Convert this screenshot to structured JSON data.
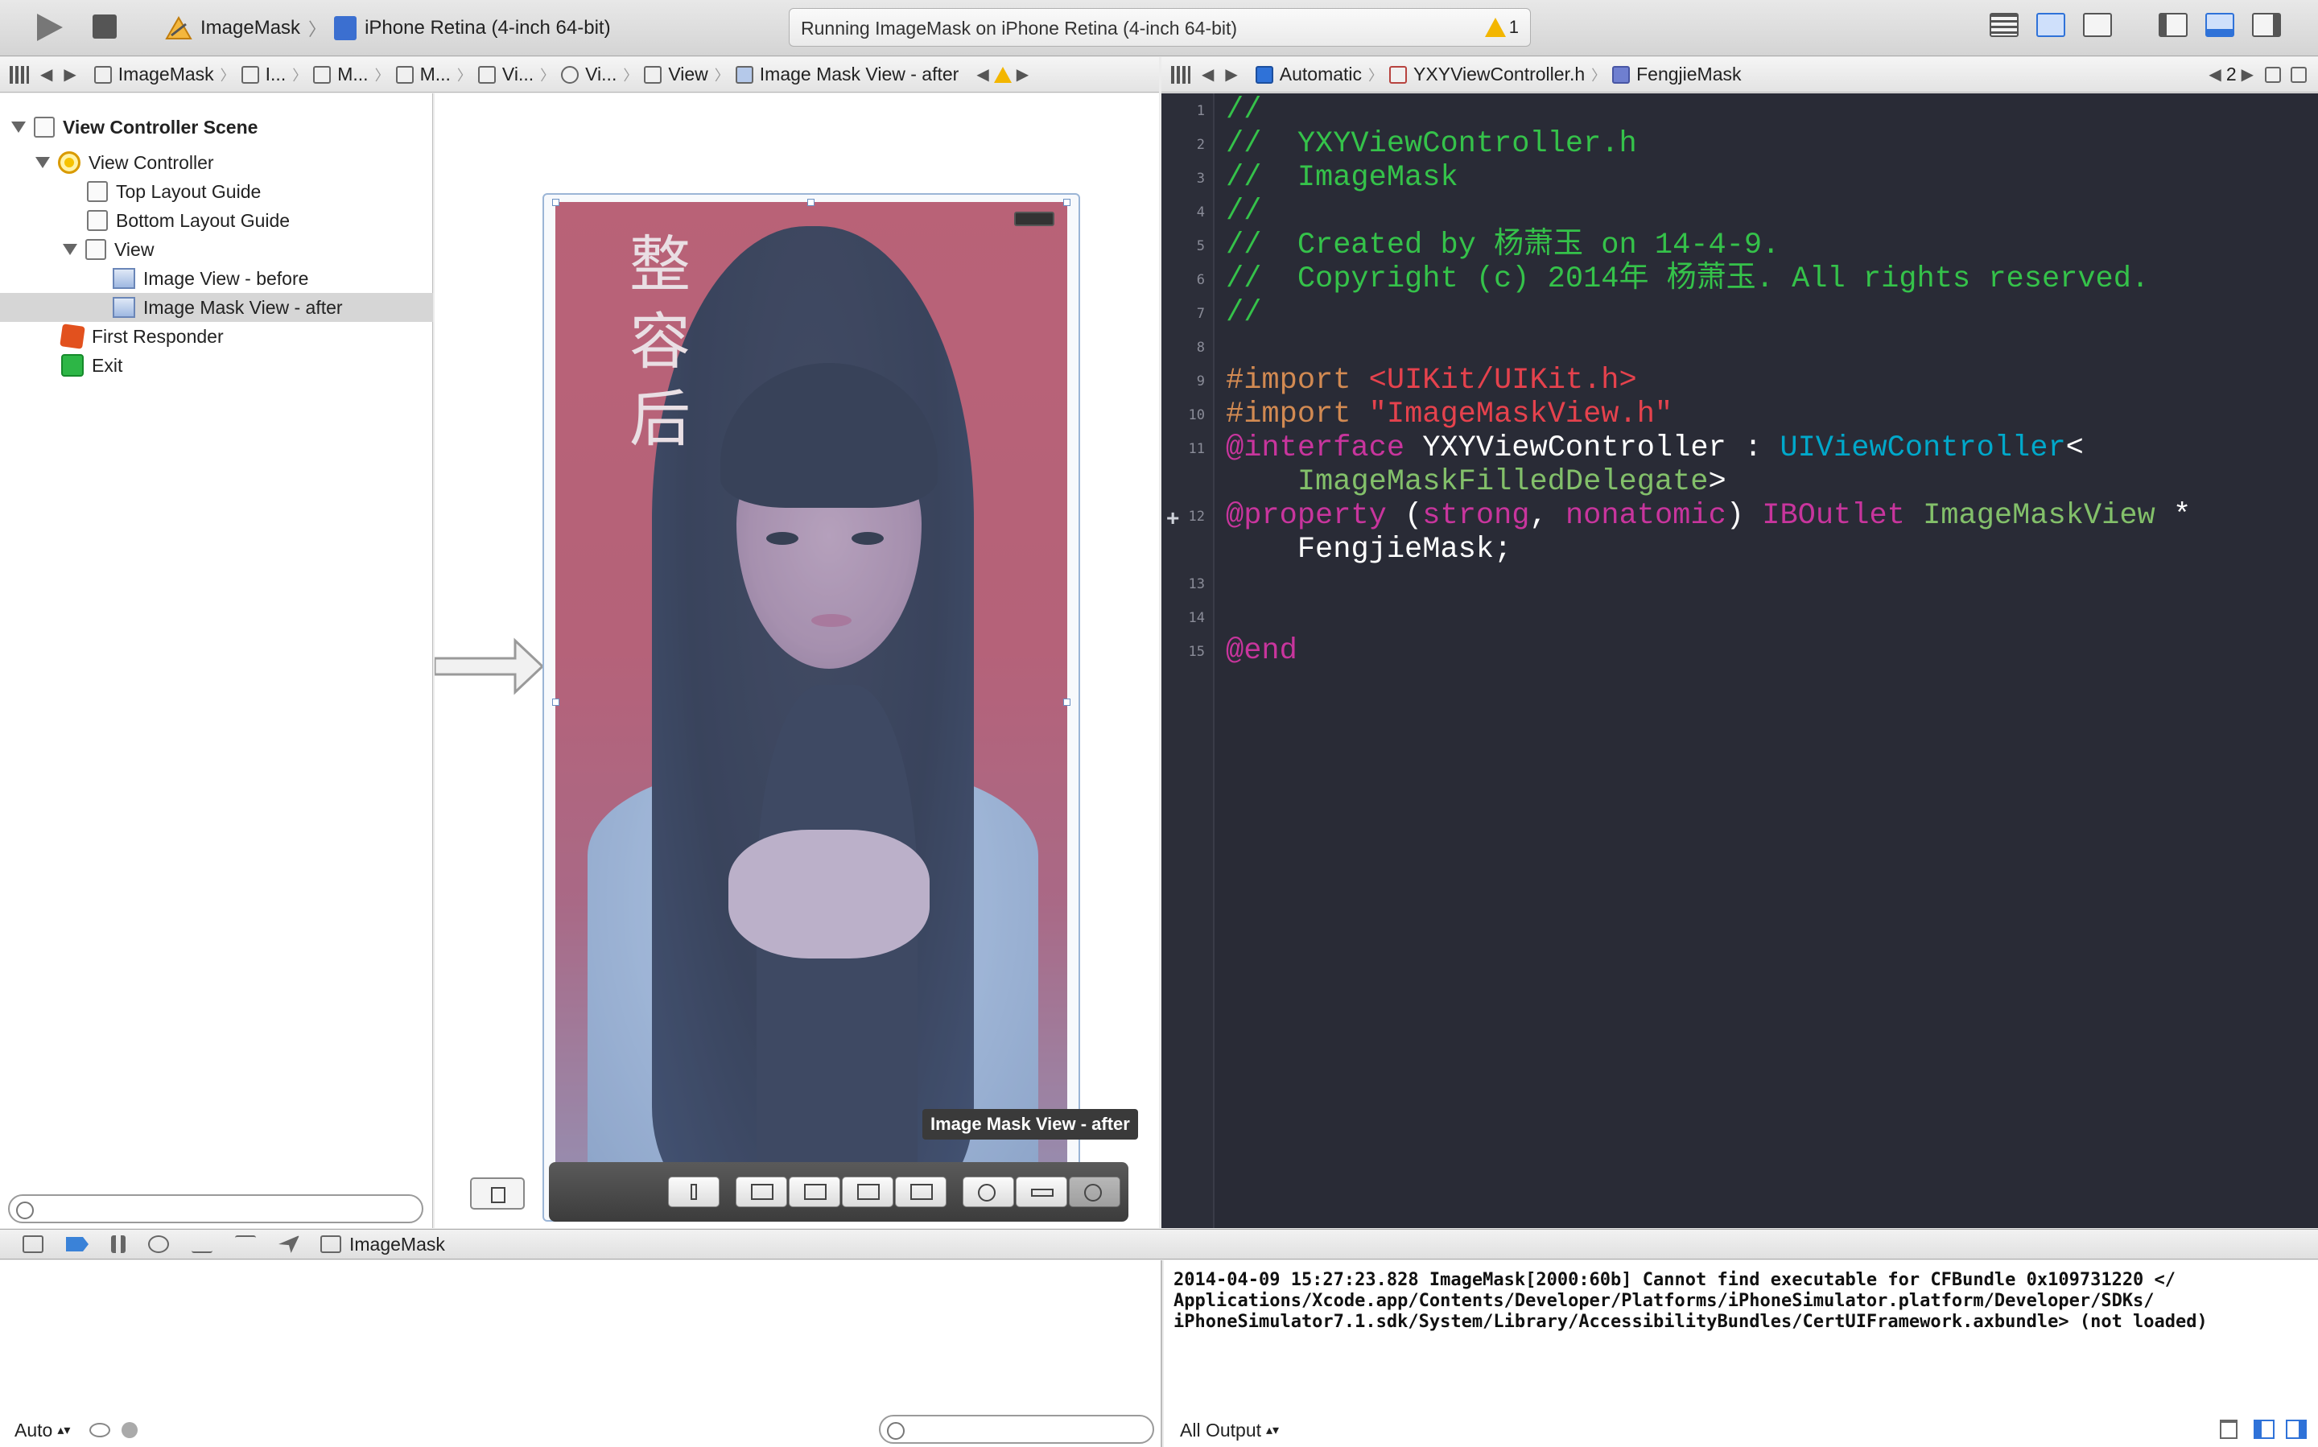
{
  "toolbar": {
    "scheme_name": "ImageMask",
    "device_name": "iPhone Retina (4-inch 64-bit)",
    "status_text": "Running ImageMask on iPhone Retina (4-inch 64-bit)",
    "warning_count": "1"
  },
  "left_jumpbar": {
    "items": [
      "ImageMask",
      "I...",
      "M...",
      "M...",
      "Vi...",
      "Vi...",
      "View",
      "Image Mask View - after"
    ]
  },
  "right_jumpbar": {
    "items": [
      "Automatic",
      "YXYViewController.h",
      "FengjieMask"
    ],
    "counter": "2"
  },
  "outline": {
    "scene": "View Controller Scene",
    "view_controller": "View Controller",
    "top_guide": "Top Layout Guide",
    "bottom_guide": "Bottom Layout Guide",
    "view": "View",
    "image_before": "Image View - before",
    "image_after": "Image Mask View - after",
    "first_responder": "First Responder",
    "exit": "Exit"
  },
  "canvas": {
    "calligraphy": "整容后",
    "tooltip": "Image Mask View - after"
  },
  "code": {
    "lines": [
      {
        "n": "1"
      },
      {
        "n": "2"
      },
      {
        "n": "3"
      },
      {
        "n": "4"
      },
      {
        "n": "5"
      },
      {
        "n": "6"
      },
      {
        "n": "7"
      },
      {
        "n": "8"
      },
      {
        "n": "9"
      },
      {
        "n": "10"
      },
      {
        "n": "11"
      },
      {
        "n": "12"
      },
      {
        "n": "13"
      },
      {
        "n": "14"
      },
      {
        "n": "15"
      }
    ],
    "l1": "//",
    "l2": "//  YXYViewController.h",
    "l3": "//  ImageMask",
    "l4": "//",
    "l5": "//  Created by 杨萧玉 on 14-4-9.",
    "l6": "//  Copyright (c) 2014年 杨萧玉. All rights reserved.",
    "l7": "//",
    "l9_kw": "#import",
    "l9_str": "<UIKit/UIKit.h>",
    "l10_kw": "#import",
    "l10_str": "\"ImageMaskView.h\"",
    "l11_kw": "@interface",
    "l11_name": "YXYViewController",
    "l11_colon": ":",
    "l11_super": "UIViewController",
    "l11_lt": "<",
    "l11b_proto": "ImageMaskFilledDelegate",
    "l11b_gt": ">",
    "l12_kw": "@property",
    "l12_open": "(",
    "l12_strong": "strong",
    "l12_comma": ",",
    "l12_nonatomic": "nonatomic",
    "l12_close": ")",
    "l12_iboutlet": "IBOutlet",
    "l12_type": "ImageMaskView",
    "l12_star": "*",
    "l12b_var": "FengjieMask;",
    "l14_end": "@end"
  },
  "debug": {
    "target": "ImageMask",
    "vars_scope": "Auto",
    "console_scope": "All Output",
    "console_output": "2014-04-09 15:27:23.828 ImageMask[2000:60b] Cannot find executable for CFBundle 0x109731220 </\nApplications/Xcode.app/Contents/Developer/Platforms/iPhoneSimulator.platform/Developer/SDKs/\niPhoneSimulator7.1.sdk/System/Library/AccessibilityBundles/CertUIFramework.axbundle> (not loaded)"
  },
  "colors": {
    "editor_bg": "#292b36",
    "comment": "#35c24a",
    "keyword": "#c8359d",
    "preprocessor": "#d28a52",
    "string": "#e5424d",
    "class": "#00a8ca"
  }
}
